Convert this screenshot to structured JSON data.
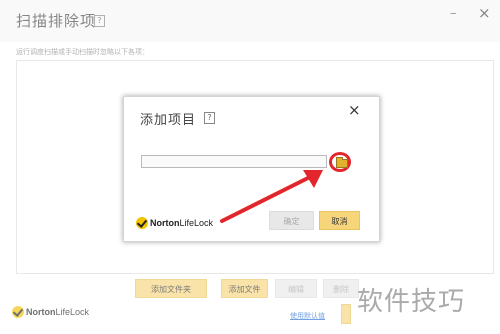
{
  "window": {
    "title": "扫描排除项",
    "help_mark": "?",
    "minimize": "–",
    "close": "×",
    "description": "运行调度扫描或手动扫描时忽略以下各项：",
    "buttons": {
      "add_folder": "添加文件夹",
      "add_file": "添加文件",
      "edit": "编辑",
      "delete": "删除"
    },
    "restore_default_link": "使用默认值"
  },
  "brand": {
    "name_bold": "Norton",
    "name_rest": "LifeLock"
  },
  "dialog": {
    "title": "添加项目",
    "help_mark": "?",
    "close": "×",
    "path_value": "",
    "ok_label": "确定",
    "cancel_label": "取消"
  },
  "watermark": "软件技巧",
  "colors": {
    "accent_button": "#f7d57a",
    "highlight_red": "#e2262c",
    "logo_yellow": "#f3c200"
  }
}
